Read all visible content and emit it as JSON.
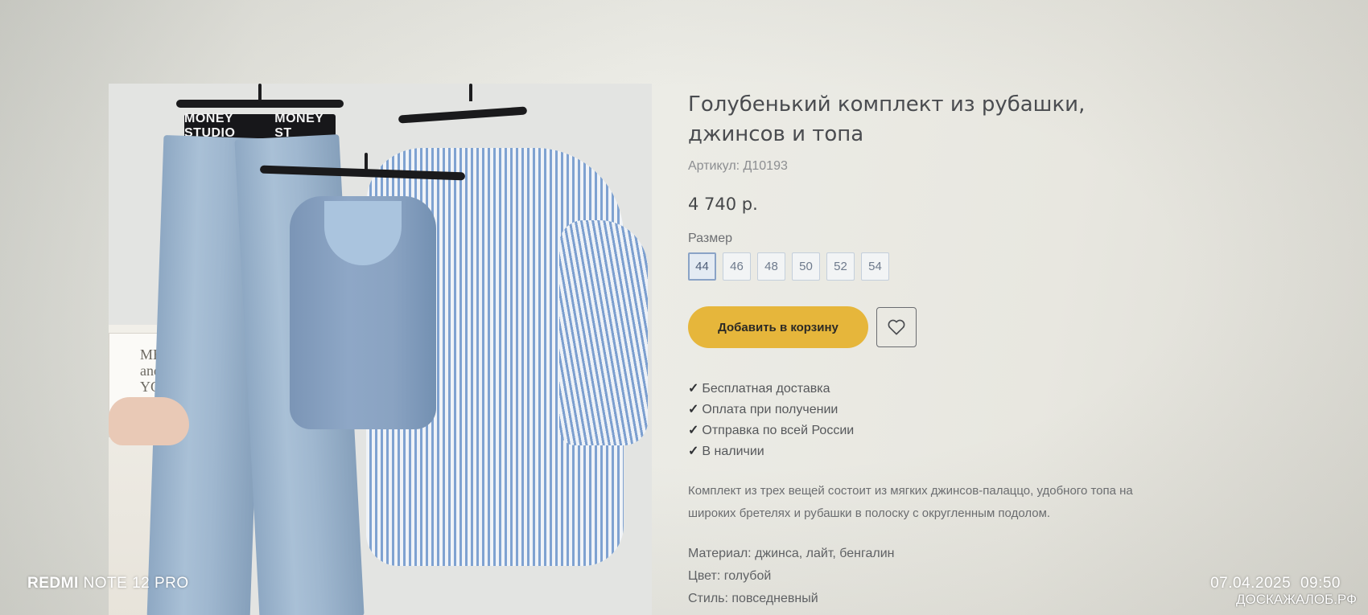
{
  "product": {
    "title": "Голубенький комплект из рубашки, джинсов и топа",
    "article": "Артикул: Д10193",
    "price": "4 740 р.",
    "size_label": "Размер",
    "sizes": [
      {
        "label": "44",
        "selected": true
      },
      {
        "label": "46",
        "selected": false
      },
      {
        "label": "48",
        "selected": false
      },
      {
        "label": "50",
        "selected": false
      },
      {
        "label": "52",
        "selected": false
      },
      {
        "label": "54",
        "selected": false
      }
    ],
    "add_to_cart_label": "Добавить в корзину",
    "favorite_icon": "heart-icon",
    "features": [
      "Бесплатная доставка",
      "Оплата при получении",
      "Отправка по всей России",
      "В наличии"
    ],
    "check_symbol": "✓",
    "description": "Комплект из трех вещей состоит из мягких джинсов-палаццо, удобного топа на широких бретелях и рубашки в полоску с округленным подолом.",
    "material": "Материал: джинса, лайт, бенгалин",
    "color": "Цвет: голубой",
    "style": "Стиль: повседневный"
  },
  "photo": {
    "waistband_text_1": "MONEY STUDIO",
    "waistband_text_2": "MONEY ST",
    "book_text": "ME and YOU"
  },
  "camera": {
    "brand": "REDMI",
    "model": "NOTE 12 PRO",
    "date": "07.04.2025",
    "time": "09:50"
  },
  "watermark": "ДОСКАЖАЛОБ.РФ",
  "colors": {
    "cart_button": "#e6b63b",
    "selected_size_border": "#8aa3c6",
    "background": "#e8e8e2"
  }
}
